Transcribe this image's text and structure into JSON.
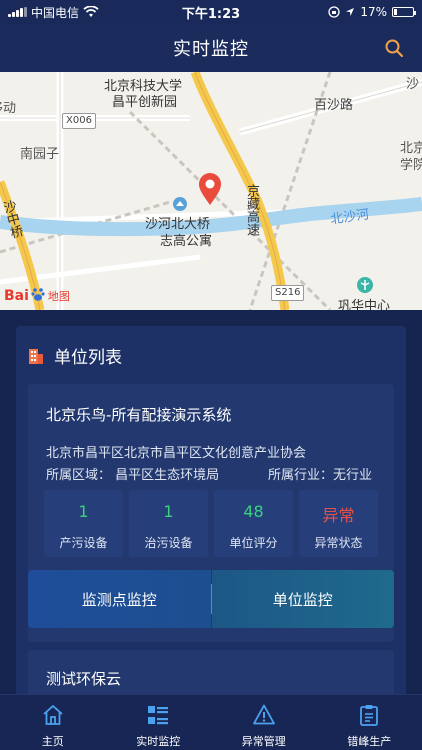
{
  "status_bar": {
    "carrier": "中国电信",
    "time": "下午1:23",
    "battery": "17%"
  },
  "header": {
    "title": "实时监控"
  },
  "map": {
    "labels": {
      "poi_university": "北京科技大学",
      "poi_university_2": "昌平创新园",
      "road_baisha": "百沙路",
      "village_nanyuanzi": "南园子",
      "road_x006": "X006",
      "poi_bridge": "沙河北大桥",
      "poi_apartment": "志高公寓",
      "highway_jingzang": "京藏高速",
      "river_beisha": "北沙河",
      "road_s216": "S216",
      "poi_gonghua": "巩华中心",
      "edge_bei": "北京",
      "edge_xueyuan": "学院",
      "edge_sha": "沙",
      "edge_dong": "移动",
      "edge_zhongqiao": "沙中桥",
      "logo_bai": "Bai",
      "logo_du": "du",
      "logo_map": "地图"
    }
  },
  "panel": {
    "title": "单位列表",
    "companies": [
      {
        "name": "北京乐鸟-所有配接演示系统",
        "address": "北京市昌平区北京市昌平区文化创意产业协会",
        "region": "所属区域：  昌平区生态环境局",
        "industry": "所属行业：无行业",
        "stats": [
          {
            "value": "1",
            "label": "产污设备"
          },
          {
            "value": "1",
            "label": "治污设备"
          },
          {
            "value": "48",
            "label": "单位评分"
          },
          {
            "value": "异常",
            "label": "异常状态"
          }
        ],
        "actions": {
          "monitor_point": "监测点监控",
          "unit_monitor": "单位监控"
        }
      },
      {
        "name": "测试环保云"
      }
    ]
  },
  "tabbar": {
    "items": [
      {
        "label": "主页",
        "icon": "home-icon"
      },
      {
        "label": "实时监控",
        "icon": "list-icon"
      },
      {
        "label": "异常管理",
        "icon": "warning-icon"
      },
      {
        "label": "错峰生产",
        "icon": "clipboard-icon"
      }
    ]
  },
  "colors": {
    "background": "#15254f",
    "accent_green": "#3ad07f",
    "abnormal_red": "#e8504a",
    "search_orange": "#f0a24a"
  }
}
